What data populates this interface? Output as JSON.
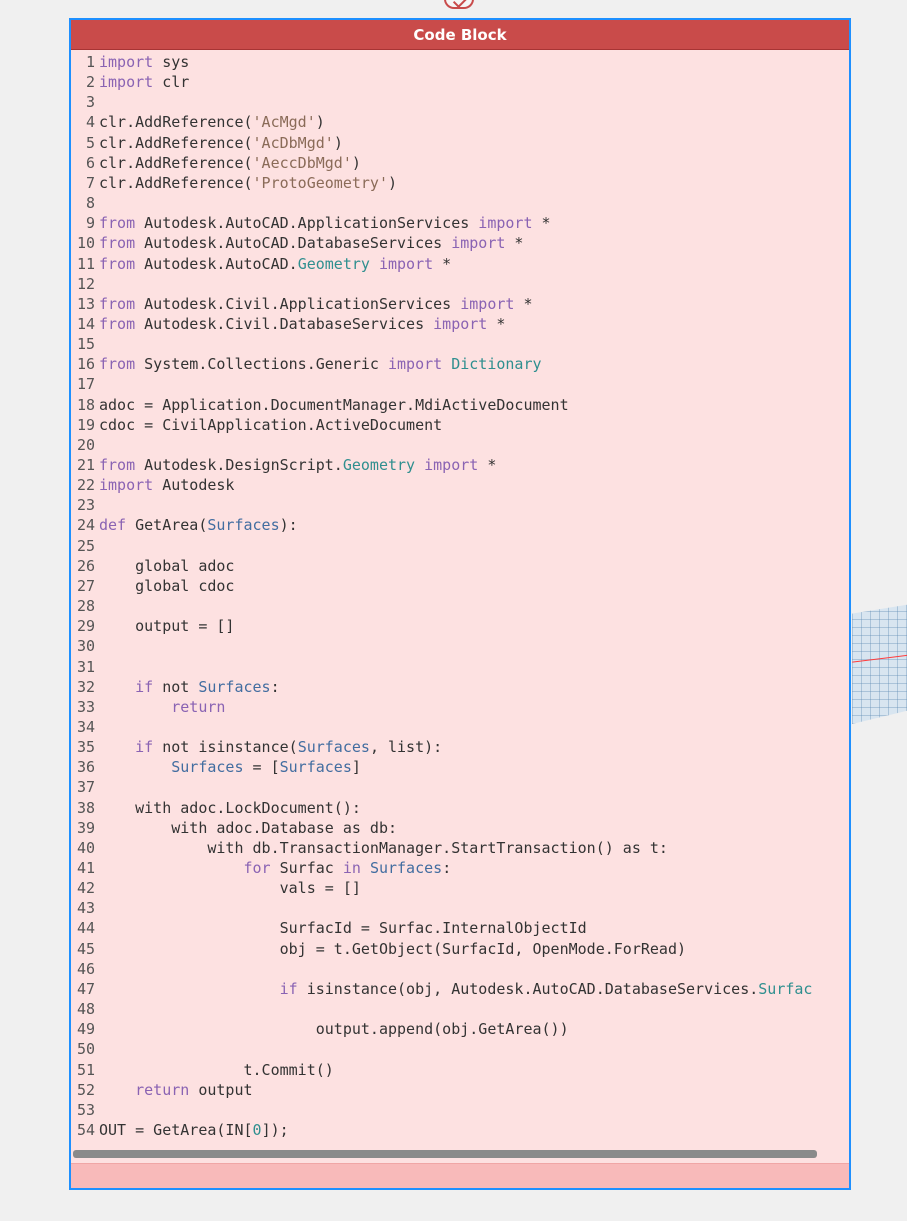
{
  "node": {
    "title": "Code Block"
  },
  "colors": {
    "header": "#c94b4a",
    "body": "#fde1e1",
    "selection_border": "#1e90ff",
    "footer": "#f8baba"
  },
  "icons": {
    "input_port": "chevron-port-icon",
    "viewport_surface": "surface-mesh-preview"
  },
  "code_lines": [
    {
      "number": "1",
      "segments": [
        {
          "t": "import",
          "c": "t-kw"
        },
        {
          "t": " sys",
          "c": "t-plain"
        }
      ]
    },
    {
      "number": "2",
      "segments": [
        {
          "t": "import",
          "c": "t-kw"
        },
        {
          "t": " clr",
          "c": "t-plain"
        }
      ]
    },
    {
      "number": "3",
      "segments": []
    },
    {
      "number": "4",
      "segments": [
        {
          "t": "clr.AddReference(",
          "c": "t-plain"
        },
        {
          "t": "'AcMgd'",
          "c": "t-str"
        },
        {
          "t": ")",
          "c": "t-plain"
        }
      ]
    },
    {
      "number": "5",
      "segments": [
        {
          "t": "clr.AddReference(",
          "c": "t-plain"
        },
        {
          "t": "'AcDbMgd'",
          "c": "t-str"
        },
        {
          "t": ")",
          "c": "t-plain"
        }
      ]
    },
    {
      "number": "6",
      "segments": [
        {
          "t": "clr.AddReference(",
          "c": "t-plain"
        },
        {
          "t": "'AeccDbMgd'",
          "c": "t-str"
        },
        {
          "t": ")",
          "c": "t-plain"
        }
      ]
    },
    {
      "number": "7",
      "segments": [
        {
          "t": "clr.AddReference(",
          "c": "t-plain"
        },
        {
          "t": "'ProtoGeometry'",
          "c": "t-str"
        },
        {
          "t": ")",
          "c": "t-plain"
        }
      ]
    },
    {
      "number": "8",
      "segments": []
    },
    {
      "number": "9",
      "segments": [
        {
          "t": "from",
          "c": "t-kw"
        },
        {
          "t": " Autodesk.AutoCAD.ApplicationServices ",
          "c": "t-plain"
        },
        {
          "t": "import",
          "c": "t-kw"
        },
        {
          "t": " *",
          "c": "t-plain"
        }
      ]
    },
    {
      "number": "10",
      "segments": [
        {
          "t": "from",
          "c": "t-kw"
        },
        {
          "t": " Autodesk.AutoCAD.DatabaseServices ",
          "c": "t-plain"
        },
        {
          "t": "import",
          "c": "t-kw"
        },
        {
          "t": " *",
          "c": "t-plain"
        }
      ]
    },
    {
      "number": "11",
      "segments": [
        {
          "t": "from",
          "c": "t-kw"
        },
        {
          "t": " Autodesk.AutoCAD.",
          "c": "t-plain"
        },
        {
          "t": "Geometry",
          "c": "t-type"
        },
        {
          "t": " ",
          "c": "t-plain"
        },
        {
          "t": "import",
          "c": "t-kw"
        },
        {
          "t": " *",
          "c": "t-plain"
        }
      ]
    },
    {
      "number": "12",
      "segments": []
    },
    {
      "number": "13",
      "segments": [
        {
          "t": "from",
          "c": "t-kw"
        },
        {
          "t": " Autodesk.Civil.ApplicationServices ",
          "c": "t-plain"
        },
        {
          "t": "import",
          "c": "t-kw"
        },
        {
          "t": " *",
          "c": "t-plain"
        }
      ]
    },
    {
      "number": "14",
      "segments": [
        {
          "t": "from",
          "c": "t-kw"
        },
        {
          "t": " Autodesk.Civil.DatabaseServices ",
          "c": "t-plain"
        },
        {
          "t": "import",
          "c": "t-kw"
        },
        {
          "t": " *",
          "c": "t-plain"
        }
      ]
    },
    {
      "number": "15",
      "segments": []
    },
    {
      "number": "16",
      "segments": [
        {
          "t": "from",
          "c": "t-kw"
        },
        {
          "t": " System.Collections.Generic ",
          "c": "t-plain"
        },
        {
          "t": "import",
          "c": "t-kw"
        },
        {
          "t": " ",
          "c": "t-plain"
        },
        {
          "t": "Dictionary",
          "c": "t-type"
        }
      ]
    },
    {
      "number": "17",
      "segments": []
    },
    {
      "number": "18",
      "segments": [
        {
          "t": "adoc = Application.DocumentManager.MdiActiveDocument",
          "c": "t-plain"
        }
      ]
    },
    {
      "number": "19",
      "segments": [
        {
          "t": "cdoc = CivilApplication.ActiveDocument",
          "c": "t-plain"
        }
      ]
    },
    {
      "number": "20",
      "segments": []
    },
    {
      "number": "21",
      "segments": [
        {
          "t": "from",
          "c": "t-kw"
        },
        {
          "t": " Autodesk.DesignScript.",
          "c": "t-plain"
        },
        {
          "t": "Geometry",
          "c": "t-type"
        },
        {
          "t": " ",
          "c": "t-plain"
        },
        {
          "t": "import",
          "c": "t-kw"
        },
        {
          "t": " *",
          "c": "t-plain"
        }
      ]
    },
    {
      "number": "22",
      "segments": [
        {
          "t": "import",
          "c": "t-kw"
        },
        {
          "t": " Autodesk",
          "c": "t-plain"
        }
      ]
    },
    {
      "number": "23",
      "segments": []
    },
    {
      "number": "24",
      "segments": [
        {
          "t": "def",
          "c": "t-kw"
        },
        {
          "t": " GetArea(",
          "c": "t-plain"
        },
        {
          "t": "Surfaces",
          "c": "t-id"
        },
        {
          "t": "):",
          "c": "t-plain"
        }
      ]
    },
    {
      "number": "25",
      "segments": []
    },
    {
      "number": "26",
      "segments": [
        {
          "t": "    global adoc",
          "c": "t-plain"
        }
      ]
    },
    {
      "number": "27",
      "segments": [
        {
          "t": "    global cdoc",
          "c": "t-plain"
        }
      ]
    },
    {
      "number": "28",
      "segments": []
    },
    {
      "number": "29",
      "segments": [
        {
          "t": "    output = []",
          "c": "t-plain"
        }
      ]
    },
    {
      "number": "30",
      "segments": []
    },
    {
      "number": "31",
      "segments": []
    },
    {
      "number": "32",
      "segments": [
        {
          "t": "    ",
          "c": "t-plain"
        },
        {
          "t": "if",
          "c": "t-kw"
        },
        {
          "t": " not ",
          "c": "t-plain"
        },
        {
          "t": "Surfaces",
          "c": "t-id"
        },
        {
          "t": ":",
          "c": "t-plain"
        }
      ]
    },
    {
      "number": "33",
      "segments": [
        {
          "t": "        ",
          "c": "t-plain"
        },
        {
          "t": "return",
          "c": "t-kw"
        }
      ]
    },
    {
      "number": "34",
      "segments": []
    },
    {
      "number": "35",
      "segments": [
        {
          "t": "    ",
          "c": "t-plain"
        },
        {
          "t": "if",
          "c": "t-kw"
        },
        {
          "t": " not isinstance(",
          "c": "t-plain"
        },
        {
          "t": "Surfaces",
          "c": "t-id"
        },
        {
          "t": ", list):",
          "c": "t-plain"
        }
      ]
    },
    {
      "number": "36",
      "segments": [
        {
          "t": "        ",
          "c": "t-plain"
        },
        {
          "t": "Surfaces",
          "c": "t-id"
        },
        {
          "t": " = [",
          "c": "t-plain"
        },
        {
          "t": "Surfaces",
          "c": "t-id"
        },
        {
          "t": "]",
          "c": "t-plain"
        }
      ]
    },
    {
      "number": "37",
      "segments": []
    },
    {
      "number": "38",
      "segments": [
        {
          "t": "    with adoc.LockDocument():",
          "c": "t-plain"
        }
      ]
    },
    {
      "number": "39",
      "segments": [
        {
          "t": "        with adoc.Database as db:",
          "c": "t-plain"
        }
      ]
    },
    {
      "number": "40",
      "segments": [
        {
          "t": "            with db.TransactionManager.StartTransaction() as t:",
          "c": "t-plain"
        }
      ]
    },
    {
      "number": "41",
      "segments": [
        {
          "t": "                ",
          "c": "t-plain"
        },
        {
          "t": "for",
          "c": "t-kw"
        },
        {
          "t": " Surfac ",
          "c": "t-plain"
        },
        {
          "t": "in",
          "c": "t-kw"
        },
        {
          "t": " ",
          "c": "t-plain"
        },
        {
          "t": "Surfaces",
          "c": "t-id"
        },
        {
          "t": ":",
          "c": "t-plain"
        }
      ]
    },
    {
      "number": "42",
      "segments": [
        {
          "t": "                    vals = []",
          "c": "t-plain"
        }
      ]
    },
    {
      "number": "43",
      "segments": []
    },
    {
      "number": "44",
      "segments": [
        {
          "t": "                    SurfacId = Surfac.InternalObjectId",
          "c": "t-plain"
        }
      ]
    },
    {
      "number": "45",
      "segments": [
        {
          "t": "                    obj = t.GetObject(SurfacId, OpenMode.ForRead)",
          "c": "t-plain"
        }
      ]
    },
    {
      "number": "46",
      "segments": []
    },
    {
      "number": "47",
      "segments": [
        {
          "t": "                    ",
          "c": "t-plain"
        },
        {
          "t": "if",
          "c": "t-kw"
        },
        {
          "t": " isinstance(obj, Autodesk.AutoCAD.DatabaseServices.",
          "c": "t-plain"
        },
        {
          "t": "Surfac",
          "c": "t-type"
        }
      ]
    },
    {
      "number": "48",
      "segments": []
    },
    {
      "number": "49",
      "segments": [
        {
          "t": "                        output.append(obj.GetArea())",
          "c": "t-plain"
        }
      ]
    },
    {
      "number": "50",
      "segments": []
    },
    {
      "number": "51",
      "segments": [
        {
          "t": "                t.Commit()",
          "c": "t-plain"
        }
      ]
    },
    {
      "number": "52",
      "segments": [
        {
          "t": "    ",
          "c": "t-plain"
        },
        {
          "t": "return",
          "c": "t-kw"
        },
        {
          "t": " output",
          "c": "t-plain"
        }
      ]
    },
    {
      "number": "53",
      "segments": []
    },
    {
      "number": "54",
      "segments": [
        {
          "t": "OUT = GetArea(IN[",
          "c": "t-plain"
        },
        {
          "t": "0",
          "c": "t-num"
        },
        {
          "t": "]);",
          "c": "t-plain"
        }
      ]
    }
  ]
}
